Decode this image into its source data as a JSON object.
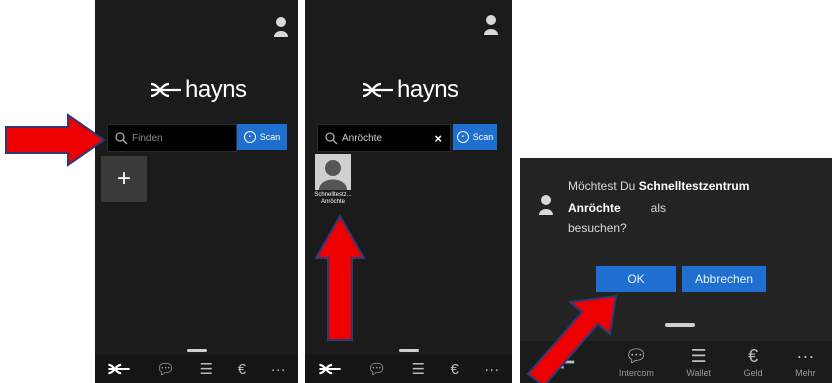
{
  "panel1": {
    "logo": "hayns",
    "search": {
      "placeholder": "Finden"
    },
    "scan_label": "Scan",
    "add_tile": "+"
  },
  "panel2": {
    "logo": "hayns",
    "search": {
      "value": "Anröchte"
    },
    "scan_label": "Scan",
    "contact": {
      "name_line1": "Schnelltestz...",
      "name_line2": "Anröchte"
    }
  },
  "panel3": {
    "dialog": {
      "line1_prefix": "Möchtest Du ",
      "line1_bold": "Schnelltestzentrum",
      "line2_bold": "Anröchte",
      "line2_rest": "als",
      "line3": "besuchen?",
      "ok_label": "OK",
      "cancel_label": "Abbrechen"
    },
    "bottom_nav": [
      "Intercom",
      "Wallet",
      "Geld",
      "Mehr"
    ]
  },
  "icons": {
    "nav": [
      "hayns-logo-icon",
      "chat-icon",
      "wallet-icon",
      "euro-icon",
      "more-icon"
    ],
    "avatar": "avatar-icon"
  },
  "colors": {
    "bg": "#1b1b1b",
    "accent": "#1f6fd0",
    "arrow": "#ff0000"
  }
}
